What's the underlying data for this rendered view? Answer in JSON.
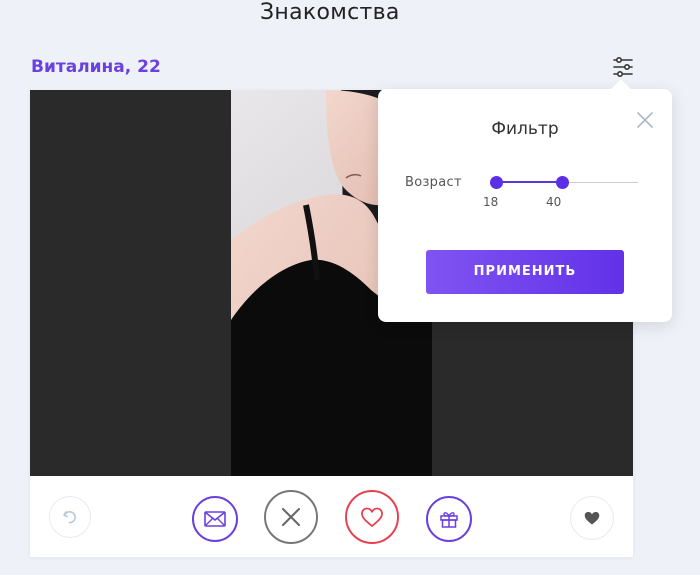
{
  "header": {
    "title": "Знакомства"
  },
  "profile": {
    "name_age": "Виталина, 22"
  },
  "filter_popup": {
    "title": "Фильтр",
    "age_label": "Возраст",
    "age_min": 18,
    "age_max": 40,
    "age_min_text": "18",
    "age_max_text": "40",
    "apply_label": "ПРИМЕНИТЬ"
  },
  "actions": [
    {
      "name": "undo-icon",
      "color": "#c7d3e3"
    },
    {
      "name": "message-icon",
      "color": "#6a3fe0"
    },
    {
      "name": "dislike-icon",
      "color": "#777777"
    },
    {
      "name": "like-icon",
      "color": "#e8414e"
    },
    {
      "name": "gift-icon",
      "color": "#6a3fe0"
    },
    {
      "name": "favorite-icon",
      "color": "#555555"
    }
  ],
  "colors": {
    "accent": "#6a40e0",
    "like": "#e8414e",
    "background": "#eef2f8"
  }
}
